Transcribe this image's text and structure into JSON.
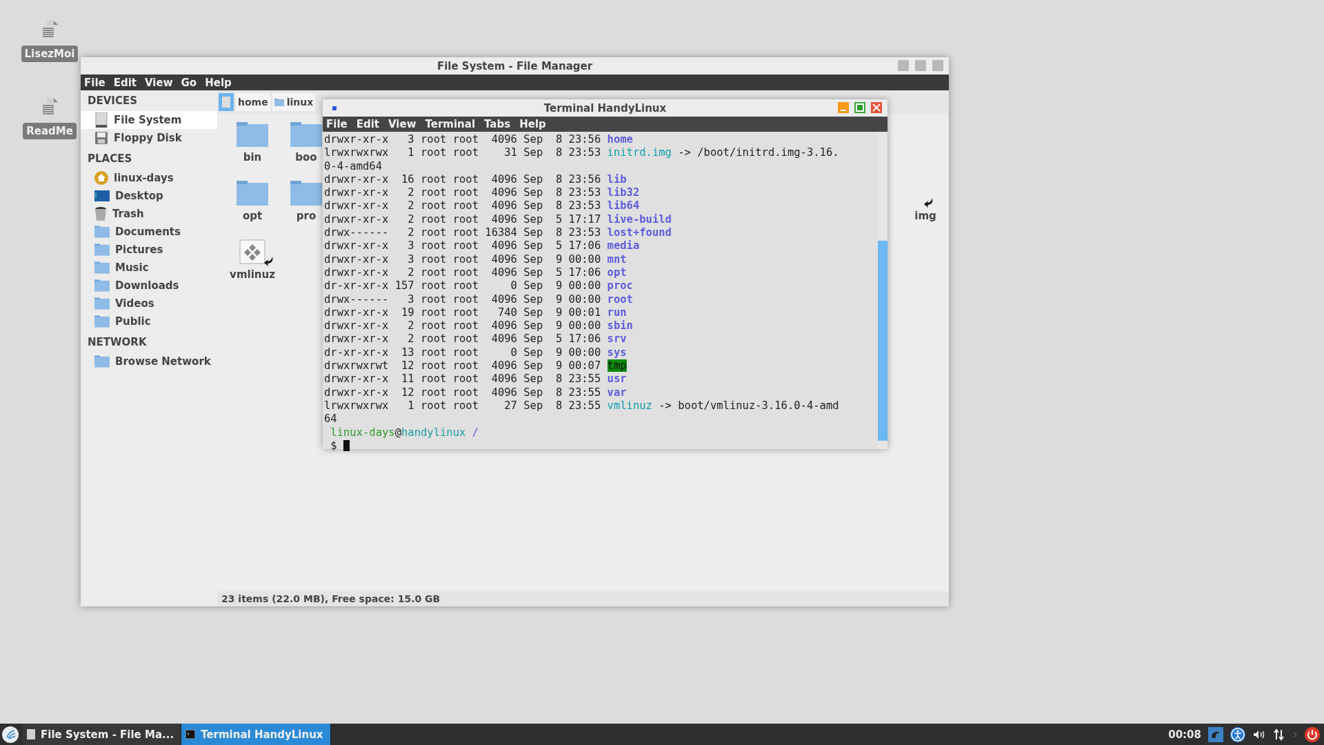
{
  "desktop_icons": [
    {
      "label": "LisezMoi"
    },
    {
      "label": "ReadMe"
    }
  ],
  "file_manager": {
    "title": "File System - File Manager",
    "menu": [
      "File",
      "Edit",
      "View",
      "Go",
      "Help"
    ],
    "sidebar": [
      {
        "heading": "DEVICES",
        "items": [
          {
            "label": "File System",
            "selected": true
          },
          {
            "label": "Floppy Disk",
            "selected": false
          }
        ]
      },
      {
        "heading": "PLACES",
        "items": [
          {
            "label": "linux-days",
            "selected": false
          },
          {
            "label": "Desktop",
            "selected": false
          },
          {
            "label": "Trash",
            "selected": false
          },
          {
            "label": "Documents",
            "selected": false
          },
          {
            "label": "Pictures",
            "selected": false
          },
          {
            "label": "Music",
            "selected": false
          },
          {
            "label": "Downloads",
            "selected": false
          },
          {
            "label": "Videos",
            "selected": false
          },
          {
            "label": "Public",
            "selected": false
          }
        ]
      },
      {
        "heading": "NETWORK",
        "items": [
          {
            "label": "Browse Network",
            "selected": false
          }
        ]
      }
    ],
    "path": [
      {
        "label": "home",
        "selected": false
      },
      {
        "label": "linux",
        "selected": false
      }
    ],
    "items": [
      {
        "label": "bin",
        "kind": "folder"
      },
      {
        "label": "boo",
        "kind": "folder"
      },
      {
        "label": "opt",
        "kind": "folder"
      },
      {
        "label": "pro",
        "kind": "folder"
      },
      {
        "label": "vmlinuz",
        "kind": "link"
      }
    ],
    "right_items": [
      {
        "label": "img",
        "kind": "hidden-link"
      }
    ],
    "status": "23 items (22.0 MB), Free space: 15.0 GB"
  },
  "terminal": {
    "title": "Terminal HandyLinux",
    "menu": [
      "File",
      "Edit",
      "View",
      "Terminal",
      "Tabs",
      "Help"
    ],
    "lines": [
      {
        "kind": "dir",
        "info": "drwxr-xr-x   3 root root  4096 Sep  8 23:56",
        "name": "home"
      },
      {
        "kind": "link",
        "info": "lrwxrwxrwx   1 root root    31 Sep  8 23:53",
        "name": "initrd.img",
        "target": "-> /boot/initrd.img-3.16."
      },
      {
        "kind": "text",
        "text": "0-4-amd64"
      },
      {
        "kind": "dir",
        "info": "drwxr-xr-x  16 root root  4096 Sep  8 23:56",
        "name": "lib"
      },
      {
        "kind": "dir",
        "info": "drwxr-xr-x   2 root root  4096 Sep  8 23:53",
        "name": "lib32"
      },
      {
        "kind": "dir",
        "info": "drwxr-xr-x   2 root root  4096 Sep  8 23:53",
        "name": "lib64"
      },
      {
        "kind": "dir",
        "info": "drwxr-xr-x   2 root root  4096 Sep  5 17:17",
        "name": "live-build"
      },
      {
        "kind": "dir",
        "info": "drwx------   2 root root 16384 Sep  8 23:53",
        "name": "lost+found"
      },
      {
        "kind": "dir",
        "info": "drwxr-xr-x   3 root root  4096 Sep  5 17:06",
        "name": "media"
      },
      {
        "kind": "dir",
        "info": "drwxr-xr-x   3 root root  4096 Sep  9 00:00",
        "name": "mnt"
      },
      {
        "kind": "dir",
        "info": "drwxr-xr-x   2 root root  4096 Sep  5 17:06",
        "name": "opt"
      },
      {
        "kind": "dir",
        "info": "dr-xr-xr-x 157 root root     0 Sep  9 00:00",
        "name": "proc"
      },
      {
        "kind": "dir",
        "info": "drwx------   3 root root  4096 Sep  9 00:00",
        "name": "root"
      },
      {
        "kind": "dir",
        "info": "drwxr-xr-x  19 root root   740 Sep  9 00:01",
        "name": "run"
      },
      {
        "kind": "dir",
        "info": "drwxr-xr-x   2 root root  4096 Sep  9 00:00",
        "name": "sbin"
      },
      {
        "kind": "dir",
        "info": "drwxr-xr-x   2 root root  4096 Sep  5 17:06",
        "name": "srv"
      },
      {
        "kind": "dir",
        "info": "dr-xr-xr-x  13 root root     0 Sep  9 00:00",
        "name": "sys"
      },
      {
        "kind": "sticky",
        "info": "drwxrwxrwt  12 root root  4096 Sep  9 00:07",
        "name": "tmp"
      },
      {
        "kind": "dir",
        "info": "drwxr-xr-x  11 root root  4096 Sep  8 23:55",
        "name": "usr"
      },
      {
        "kind": "dir",
        "info": "drwxr-xr-x  12 root root  4096 Sep  8 23:55",
        "name": "var"
      },
      {
        "kind": "link",
        "info": "lrwxrwxrwx   1 root root    27 Sep  8 23:55",
        "name": "vmlinuz",
        "target": "-> boot/vmlinuz-3.16.0-4-amd"
      },
      {
        "kind": "text",
        "text": "64"
      },
      {
        "kind": "prompt",
        "user": "linux-days",
        "at": "@",
        "host": "handylinux",
        "path": "/"
      },
      {
        "kind": "input",
        "symbol": "$"
      }
    ]
  },
  "taskbar": {
    "tasks": [
      {
        "label": "File System - File Ma...",
        "selected": false
      },
      {
        "label": "Terminal HandyLinux",
        "selected": true
      }
    ],
    "clock": "00:08"
  }
}
